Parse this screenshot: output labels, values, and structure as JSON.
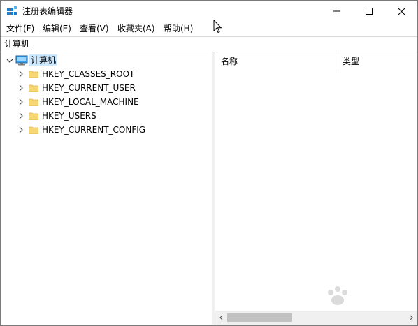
{
  "window": {
    "title": "注册表编辑器"
  },
  "menu": [
    "文件(F)",
    "编辑(E)",
    "查看(V)",
    "收藏夹(A)",
    "帮助(H)"
  ],
  "address": "计算机",
  "tree": {
    "root": "计算机",
    "items": [
      "HKEY_CLASSES_ROOT",
      "HKEY_CURRENT_USER",
      "HKEY_LOCAL_MACHINE",
      "HKEY_USERS",
      "HKEY_CURRENT_CONFIG"
    ]
  },
  "list": {
    "columns": [
      "名称",
      "类型"
    ]
  },
  "colors": {
    "folder": "#f7d774",
    "selection": "#cce8ff",
    "accent": "#0078d7"
  },
  "icons": {
    "app": "regedit-icon",
    "computer": "computer-icon",
    "folder": "folder-icon"
  }
}
